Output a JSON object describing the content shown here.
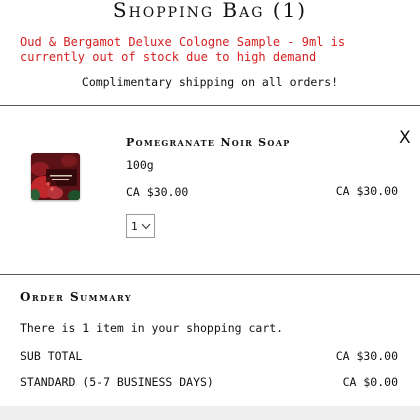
{
  "header": {
    "title": "Shopping Bag (1)"
  },
  "notices": {
    "stock_warning": "Oud & Bergamot Deluxe Cologne Sample - 9ml is currently out of stock due to high demand",
    "shipping": "Complimentary shipping on all orders!"
  },
  "cart": {
    "items": [
      {
        "name": "Pomegranate Noir Soap",
        "size": "100g",
        "unit_price": "CA $30.00",
        "total_price": "CA $30.00",
        "quantity": "1",
        "remove_label": "X"
      }
    ]
  },
  "summary": {
    "title": "Order Summary",
    "item_count_text": "There is 1 item in your shopping cart.",
    "subtotal_label": "SUB TOTAL",
    "subtotal_value": "CA $30.00",
    "shipping_label": "STANDARD (5-7 BUSINESS DAYS)",
    "shipping_value": "CA $0.00"
  },
  "colors": {
    "warning": "#d51f1f",
    "divider": "#555555",
    "footer_bar": "#eeeeee"
  },
  "icons": {
    "quantity_dropdown": "chevron-down-icon",
    "remove": "close-icon"
  }
}
